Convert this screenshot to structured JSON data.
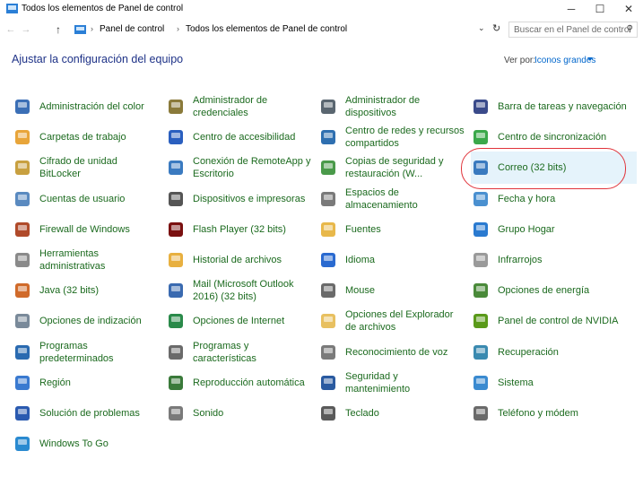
{
  "window": {
    "title": "Todos los elementos de Panel de control",
    "min": "─",
    "max": "☐",
    "close": "✕"
  },
  "address": {
    "back": "←",
    "forward": "→",
    "up": "↑",
    "sep": "›",
    "crumbs": [
      "Panel de control",
      "Todos los elementos de Panel de control"
    ],
    "dropdown": "⌄",
    "refresh": "↻",
    "search_placeholder": "Buscar en el Panel de control",
    "search_glyph": "⚲"
  },
  "header": {
    "title": "Ajustar la configuración del equipo",
    "viewby_label": "Ver por:",
    "viewby_value": "Iconos grandes"
  },
  "items": [
    {
      "label": "Administración del color",
      "icon": "color-management-icon",
      "color": "#3b6fb6"
    },
    {
      "label": "Administrador de credenciales",
      "icon": "credential-manager-icon",
      "color": "#8a7a3a"
    },
    {
      "label": "Administrador de dispositivos",
      "icon": "device-manager-icon",
      "color": "#5a6670"
    },
    {
      "label": "Barra de tareas y navegación",
      "icon": "taskbar-icon",
      "color": "#3a4a8a"
    },
    {
      "label": "Carpetas de trabajo",
      "icon": "work-folders-icon",
      "color": "#e8a53a"
    },
    {
      "label": "Centro de accesibilidad",
      "icon": "accessibility-icon",
      "color": "#2a5fbf"
    },
    {
      "label": "Centro de redes y recursos compartidos",
      "icon": "network-center-icon",
      "color": "#2e6fb0"
    },
    {
      "label": "Centro de sincronización",
      "icon": "sync-center-icon",
      "color": "#3aa84a"
    },
    {
      "label": "Cifrado de unidad BitLocker",
      "icon": "bitlocker-icon",
      "color": "#c8a040"
    },
    {
      "label": "Conexión de RemoteApp y Escritorio",
      "icon": "remoteapp-icon",
      "color": "#3a7ac0"
    },
    {
      "label": "Copias de seguridad y restauración (W...",
      "icon": "backup-icon",
      "color": "#4a9a4a"
    },
    {
      "label": "Correo (32 bits)",
      "icon": "mail-icon",
      "color": "#3a7abf"
    },
    {
      "label": "Cuentas de usuario",
      "icon": "user-accounts-icon",
      "color": "#5a8ac0"
    },
    {
      "label": "Dispositivos e impresoras",
      "icon": "devices-printers-icon",
      "color": "#555555"
    },
    {
      "label": "Espacios de almacenamiento",
      "icon": "storage-spaces-icon",
      "color": "#7a7a7a"
    },
    {
      "label": "Fecha y hora",
      "icon": "date-time-icon",
      "color": "#4a90d0"
    },
    {
      "label": "Firewall de Windows",
      "icon": "firewall-icon",
      "color": "#b04a2a"
    },
    {
      "label": "Flash Player (32 bits)",
      "icon": "flash-icon",
      "color": "#7a1010"
    },
    {
      "label": "Fuentes",
      "icon": "fonts-icon",
      "color": "#e8b84a"
    },
    {
      "label": "Grupo Hogar",
      "icon": "homegroup-icon",
      "color": "#2a7ad0"
    },
    {
      "label": "Herramientas administrativas",
      "icon": "admin-tools-icon",
      "color": "#8a8a8a"
    },
    {
      "label": "Historial de archivos",
      "icon": "file-history-icon",
      "color": "#e8b040"
    },
    {
      "label": "Idioma",
      "icon": "language-icon",
      "color": "#2a6ad0"
    },
    {
      "label": "Infrarrojos",
      "icon": "infrared-icon",
      "color": "#9a9a9a"
    },
    {
      "label": "Java (32 bits)",
      "icon": "java-icon",
      "color": "#d06a2a"
    },
    {
      "label": "Mail (Microsoft Outlook 2016) (32 bits)",
      "icon": "outlook-mail-icon",
      "color": "#3a6ab0"
    },
    {
      "label": "Mouse",
      "icon": "mouse-icon",
      "color": "#6a6a6a"
    },
    {
      "label": "Opciones de energía",
      "icon": "power-options-icon",
      "color": "#4a8a3a"
    },
    {
      "label": "Opciones de indización",
      "icon": "indexing-icon",
      "color": "#7a8a9a"
    },
    {
      "label": "Opciones de Internet",
      "icon": "internet-options-icon",
      "color": "#2a8a4a"
    },
    {
      "label": "Opciones del Explorador de archivos",
      "icon": "explorer-options-icon",
      "color": "#e8c060"
    },
    {
      "label": "Panel de control de NVIDIA",
      "icon": "nvidia-icon",
      "color": "#5a9a1a"
    },
    {
      "label": "Programas predeterminados",
      "icon": "default-programs-icon",
      "color": "#2a6ab0"
    },
    {
      "label": "Programas y características",
      "icon": "programs-features-icon",
      "color": "#6a6a6a"
    },
    {
      "label": "Reconocimiento de voz",
      "icon": "speech-icon",
      "color": "#7a7a7a"
    },
    {
      "label": "Recuperación",
      "icon": "recovery-icon",
      "color": "#3a8ab0"
    },
    {
      "label": "Región",
      "icon": "region-icon",
      "color": "#3a7ad0"
    },
    {
      "label": "Reproducción automática",
      "icon": "autoplay-icon",
      "color": "#3a7a3a"
    },
    {
      "label": "Seguridad y mantenimiento",
      "icon": "security-maintenance-icon",
      "color": "#2a5aa0"
    },
    {
      "label": "Sistema",
      "icon": "system-icon",
      "color": "#3a8ad0"
    },
    {
      "label": "Solución de problemas",
      "icon": "troubleshooting-icon",
      "color": "#2a5ab0"
    },
    {
      "label": "Sonido",
      "icon": "sound-icon",
      "color": "#7a7a7a"
    },
    {
      "label": "Teclado",
      "icon": "keyboard-icon",
      "color": "#5a5a5a"
    },
    {
      "label": "Teléfono y módem",
      "icon": "phone-modem-icon",
      "color": "#6a6a6a"
    },
    {
      "label": "Windows To Go",
      "icon": "windows-to-go-icon",
      "color": "#2a8ad0"
    }
  ],
  "selected_label": "Correo (32 bits)"
}
